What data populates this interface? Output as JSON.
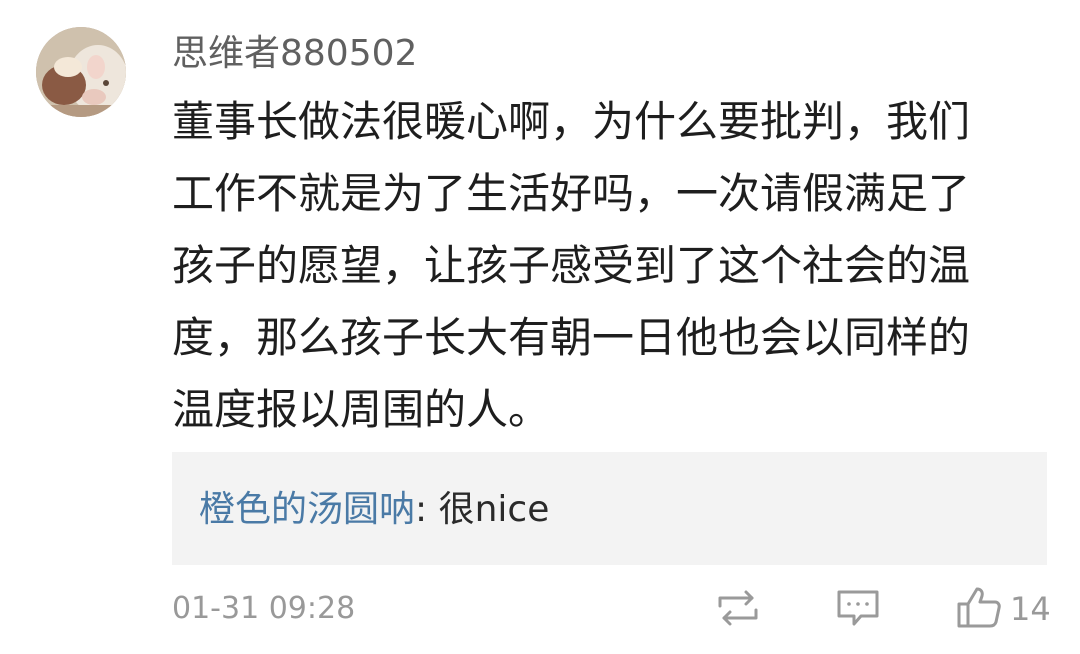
{
  "post": {
    "author": "思维者880502",
    "content_lines": [
      "董事长做法很暖心啊，为什么要批判，我们",
      "工作不就是为了生活好吗，一次请假满足了",
      "孩子的愿望，让孩子感受到了这个社会的温",
      "度，那么孩子长大有朝一日他也会以同样的",
      "温度报以周围的人。"
    ]
  },
  "reply": {
    "author": "橙色的汤圆呐",
    "separator": ": ",
    "text": "很nice"
  },
  "footer": {
    "timestamp": "01-31 09:28",
    "like_count": "14"
  },
  "icons": {
    "avatar": "pig-avatar",
    "repost": "repost-icon",
    "comment": "comment-icon",
    "like": "thumbs-up-icon"
  },
  "colors": {
    "reply_author": "#4a7aa6",
    "meta_gray": "#999999",
    "reply_bg": "#f3f3f3"
  }
}
